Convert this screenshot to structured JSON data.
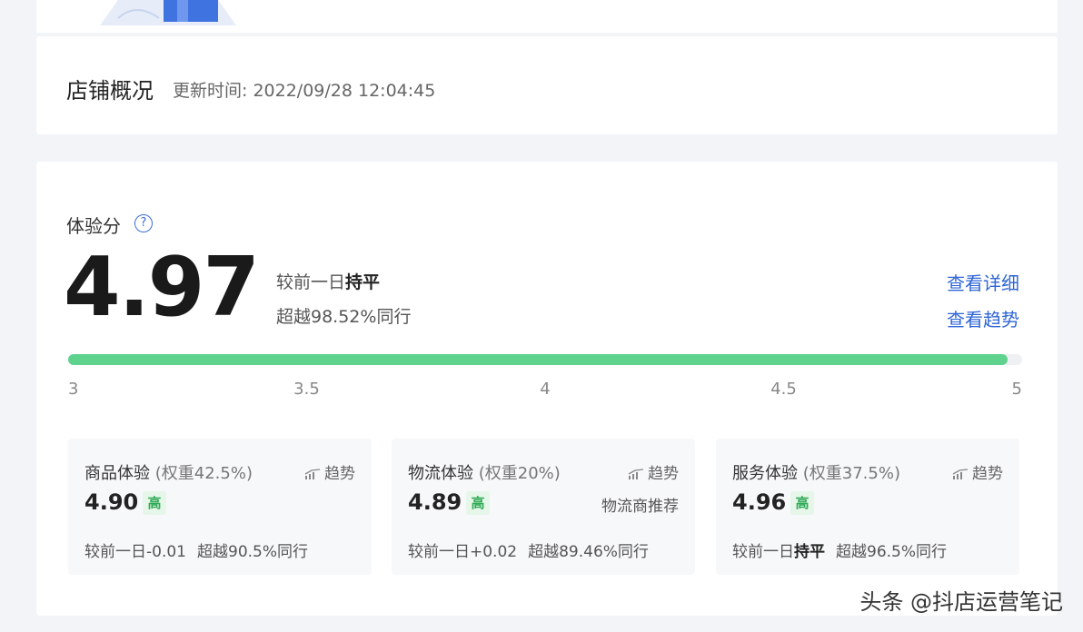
{
  "overview": {
    "title": "店铺概况",
    "update_time": "更新时间: 2022/09/28 12:04:45"
  },
  "experience": {
    "label": "体验分",
    "help_glyph": "?",
    "score": "4.97",
    "compare_prefix": "较前一日",
    "compare_value": "持平",
    "beat": "超越98.52%同行",
    "link_detail": "查看详细",
    "link_trend": "查看趋势",
    "progress": {
      "min": 3,
      "max": 5,
      "value": 4.97
    },
    "ticks": [
      "3",
      "3.5",
      "4",
      "4.5",
      "5"
    ]
  },
  "sub_scores": [
    {
      "title": "商品体验",
      "weight": "(权重42.5%)",
      "trend": "趋势",
      "score": "4.90",
      "badge": "高",
      "extra": "",
      "compare": "较前一日-0.01",
      "beat": "超越90.5%同行"
    },
    {
      "title": "物流体验",
      "weight": "(权重20%)",
      "trend": "趋势",
      "score": "4.89",
      "badge": "高",
      "extra": "物流商推荐",
      "compare": "较前一日+0.02",
      "beat": "超越89.46%同行"
    },
    {
      "title": "服务体验",
      "weight": "(权重37.5%)",
      "trend": "趋势",
      "score": "4.96",
      "badge": "高",
      "extra": "",
      "compare_prefix": "较前一日",
      "compare_value": "持平",
      "beat": "超越96.5%同行"
    }
  ],
  "watermark": "头条 @抖店运营笔记",
  "colors": {
    "accent": "#2f66d6",
    "progress": "#5fd38d",
    "badge": "#2faa55"
  }
}
